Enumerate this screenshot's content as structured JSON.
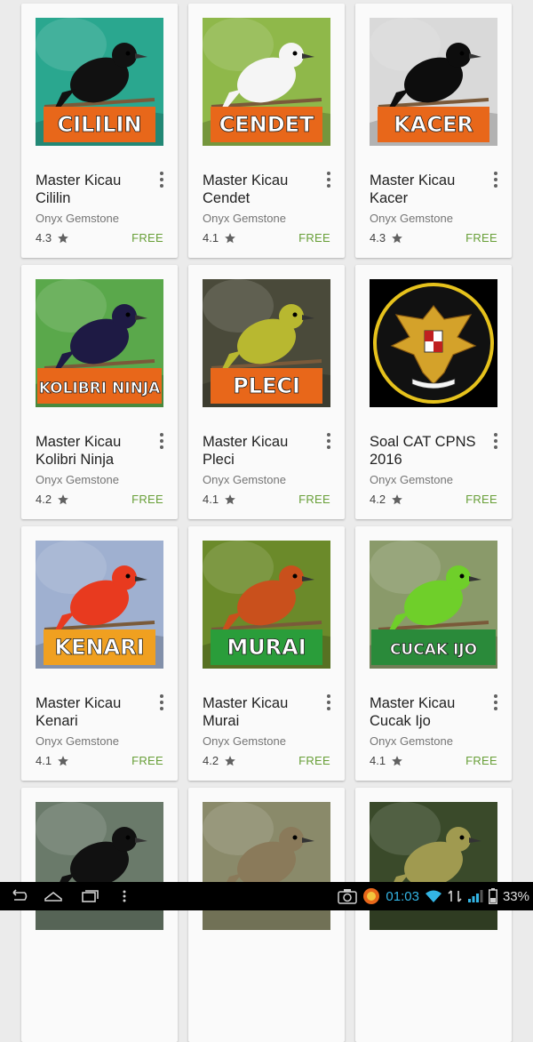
{
  "apps": [
    {
      "title": "Master Kicau Cililin",
      "developer": "Onyx Gemstone",
      "rating": "4.3",
      "price": "FREE",
      "banner": "CILILIN",
      "banner_color": "#e8671a",
      "bg": "#2aa78f",
      "bird": "#111111"
    },
    {
      "title": "Master Kicau Cendet",
      "developer": "Onyx Gemstone",
      "rating": "4.1",
      "price": "FREE",
      "banner": "CENDET",
      "banner_color": "#e8671a",
      "bg": "#8fb84a",
      "bird": "#f5f5f5"
    },
    {
      "title": "Master Kicau Kacer",
      "developer": "Onyx Gemstone",
      "rating": "4.3",
      "price": "FREE",
      "banner": "KACER",
      "banner_color": "#e8671a",
      "bg": "#d9d9d9",
      "bird": "#0d0d0d"
    },
    {
      "title": "Master Kicau Kolibri Ninja",
      "developer": "Onyx Gemstone",
      "rating": "4.2",
      "price": "FREE",
      "banner": "KOLIBRI NINJA",
      "banner_color": "#e8671a",
      "bg": "#5aa84b",
      "bird": "#1e1a44"
    },
    {
      "title": "Master Kicau Pleci",
      "developer": "Onyx Gemstone",
      "rating": "4.1",
      "price": "FREE",
      "banner": "PLECI",
      "banner_color": "#e8671a",
      "bg": "#4a4a3a",
      "bird": "#b8b830"
    },
    {
      "title": "Soal CAT CPNS 2016",
      "developer": "Onyx Gemstone",
      "rating": "4.2",
      "price": "FREE",
      "banner": "",
      "banner_color": "",
      "bg": "#000000",
      "bird": "#d4a22a"
    },
    {
      "title": "Master Kicau Kenari",
      "developer": "Onyx Gemstone",
      "rating": "4.1",
      "price": "FREE",
      "banner": "KENARI",
      "banner_color": "#f0a020",
      "bg": "#9fb0d0",
      "bird": "#e83a1f"
    },
    {
      "title": "Master Kicau Murai",
      "developer": "Onyx Gemstone",
      "rating": "4.2",
      "price": "FREE",
      "banner": "MURAI",
      "banner_color": "#2a9d3a",
      "bg": "#6b8a2a",
      "bird": "#c9501c"
    },
    {
      "title": "Master Kicau Cucak Ijo",
      "developer": "Onyx Gemstone",
      "rating": "4.1",
      "price": "FREE",
      "banner": "CUCAK IJO",
      "banner_color": "#2a8a3a",
      "bg": "#8a9a6a",
      "bird": "#6fcf2a"
    },
    {
      "title": "",
      "developer": "",
      "rating": "",
      "price": "",
      "banner": "",
      "banner_color": "",
      "bg": "#6a7a6a",
      "bird": "#111111"
    },
    {
      "title": "",
      "developer": "",
      "rating": "",
      "price": "",
      "banner": "",
      "banner_color": "",
      "bg": "#8a8a6a",
      "bird": "#8a7a5a"
    },
    {
      "title": "",
      "developer": "",
      "rating": "",
      "price": "",
      "banner": "",
      "banner_color": "",
      "bg": "#3a4a2a",
      "bird": "#a09a50"
    }
  ],
  "status_bar": {
    "time": "01:03",
    "battery": "33%",
    "time_color": "#33b5e5"
  }
}
